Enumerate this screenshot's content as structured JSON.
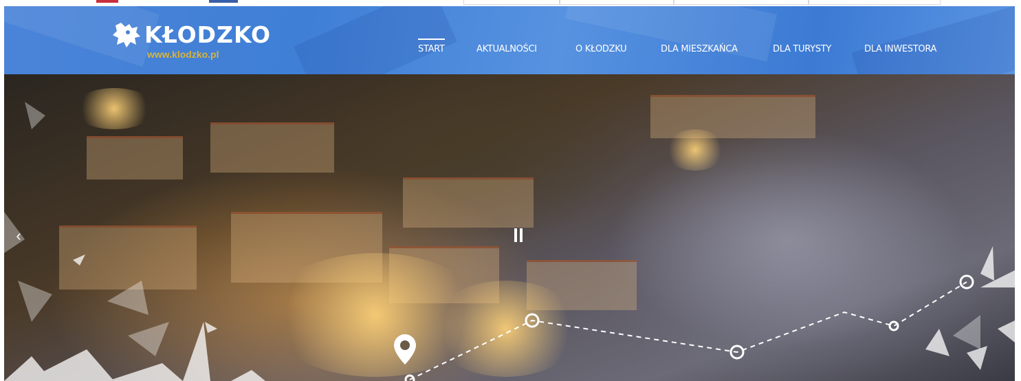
{
  "site": {
    "name": "KŁODZKO",
    "url": "www.klodzko.pl"
  },
  "nav": {
    "items": [
      {
        "label": "START",
        "active": true
      },
      {
        "label": "AKTUALNOŚCI",
        "active": false
      },
      {
        "label": "O KŁODZKU",
        "active": false
      },
      {
        "label": "DLA MIESZKAŃCA",
        "active": false
      },
      {
        "label": "DLA TURYSTY",
        "active": false
      },
      {
        "label": "DLA INWESTORA",
        "active": false
      }
    ]
  },
  "slider": {
    "prev_icon": "chevron-left-icon",
    "pause_icon": "pause-icon",
    "map_pin_icon": "map-pin-icon"
  },
  "colors": {
    "header": "#4a84d8",
    "logo_url": "#d8b43a",
    "text": "#ffffff"
  }
}
